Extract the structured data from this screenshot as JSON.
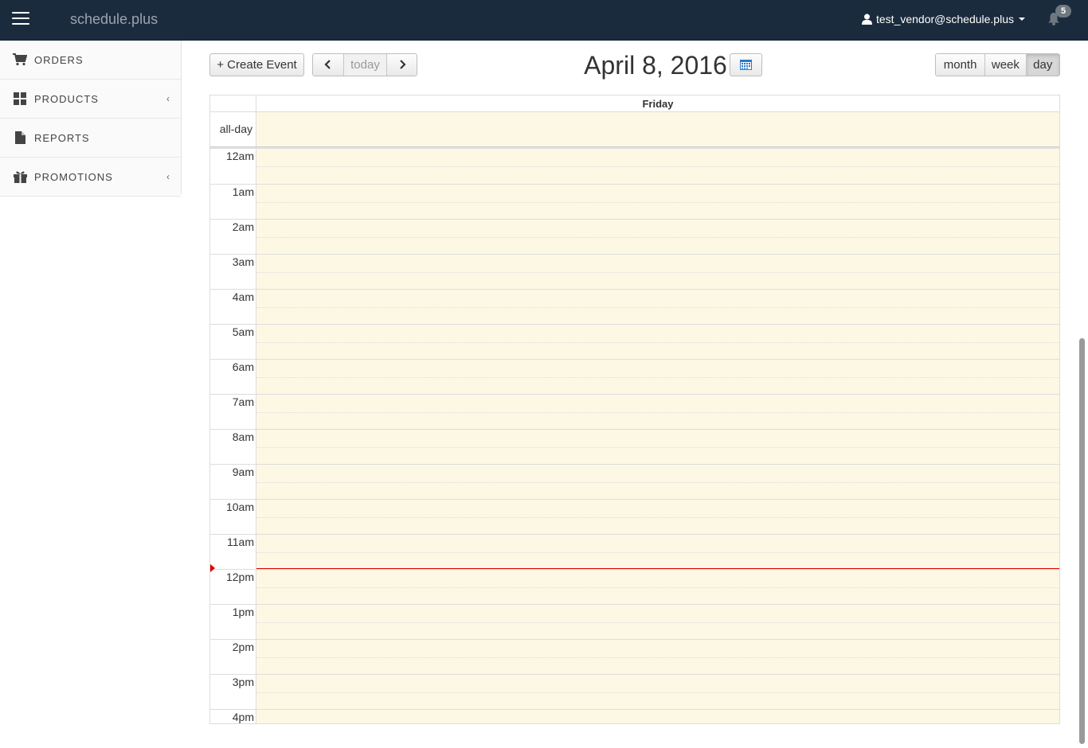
{
  "navbar": {
    "brand": "schedule.plus",
    "user_email": "test_vendor@schedule.plus",
    "notification_count": "5"
  },
  "sidebar": {
    "items": [
      {
        "label": "ORDERS",
        "icon": "cart-icon",
        "has_submenu": false
      },
      {
        "label": "PRODUCTS",
        "icon": "grid-icon",
        "has_submenu": true
      },
      {
        "label": "REPORTS",
        "icon": "file-icon",
        "has_submenu": false
      },
      {
        "label": "PROMOTIONS",
        "icon": "gift-icon",
        "has_submenu": true
      }
    ]
  },
  "toolbar": {
    "create_label": "+ Create Event",
    "today_label": "today",
    "title": "April 8, 2016",
    "views": [
      "month",
      "week",
      "day"
    ],
    "active_view": "day"
  },
  "calendar": {
    "day_name": "Friday",
    "allday_label": "all-day",
    "hours": [
      "12am",
      "1am",
      "2am",
      "3am",
      "4am",
      "5am",
      "6am",
      "7am",
      "8am",
      "9am",
      "10am",
      "11am",
      "12pm",
      "1pm",
      "2pm",
      "3pm",
      "4pm"
    ],
    "now_hour": 11.98,
    "colors": {
      "highlight": "#fcf8e3",
      "now_indicator": "#dd0000"
    }
  }
}
